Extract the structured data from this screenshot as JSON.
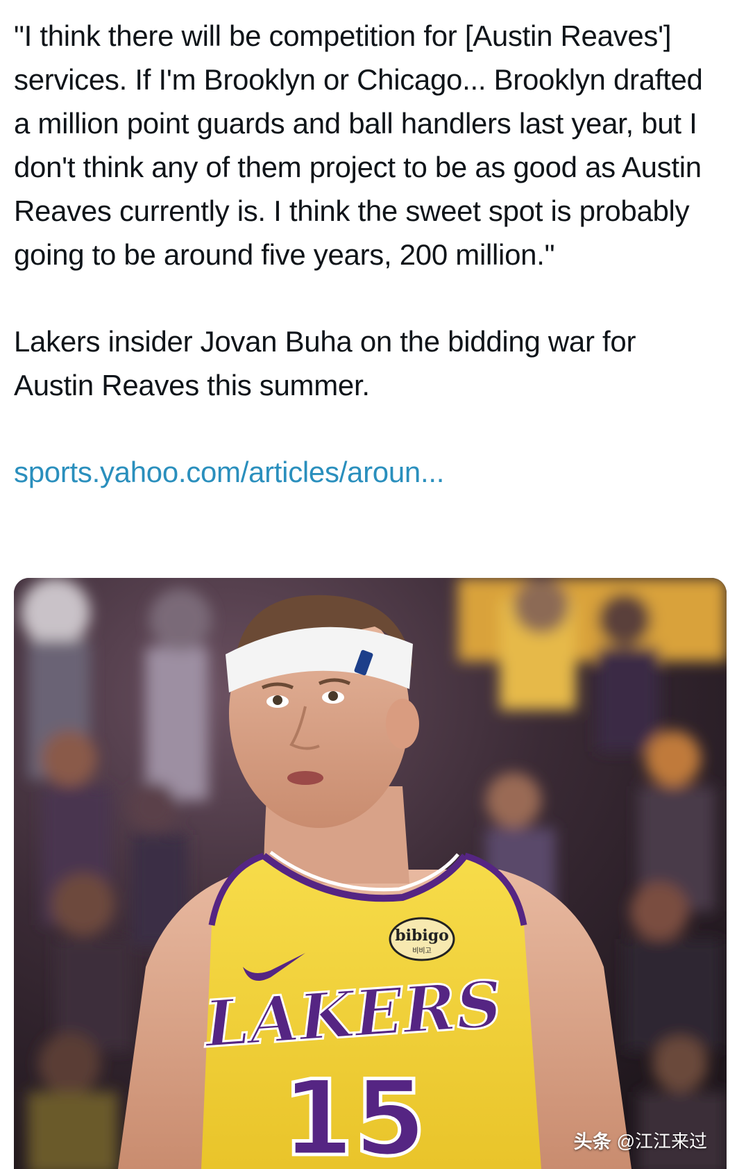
{
  "post": {
    "quote_text": "\"I think there will be competition for [Austin Reaves'] services. If I'm Brooklyn or Chicago... Brooklyn drafted a million point guards and ball handlers last year, but I don't think any of them project to be as good as Austin Reaves currently is. I think the sweet spot is probably going to be around five years, 200 million.\"",
    "caption_text": "Lakers insider Jovan Buha on the bidding war for Austin Reaves this summer.",
    "link_text": "sports.yahoo.com/articles/aroun..."
  },
  "media": {
    "jersey_brand": "LAKERS",
    "jersey_number": "15",
    "sponsor": "bibigo",
    "sponsor_sub": "비비고"
  },
  "watermark": {
    "brand": "头条",
    "handle": "@江江来过"
  },
  "colors": {
    "link": "#2a8fbd",
    "jersey_gold": "#f5d33a",
    "jersey_purple": "#552583",
    "text": "#0f1419"
  }
}
